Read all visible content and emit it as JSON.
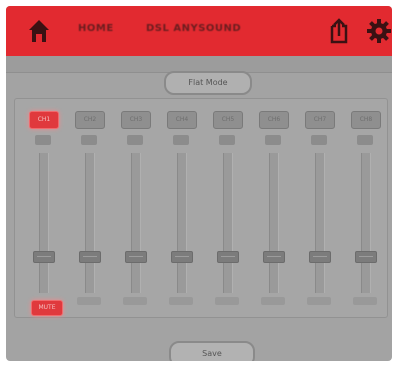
{
  "header": {
    "left_label": "HOME",
    "title": "DSL ANYSOUND",
    "home_icon": "home-icon",
    "share_icon": "share-icon",
    "settings_icon": "gear-icon",
    "bar_color": "#e22a30"
  },
  "preset_label": "Flat Mode",
  "channels": [
    {
      "label": "CH1",
      "active": true
    },
    {
      "label": "CH2",
      "active": false
    },
    {
      "label": "CH3",
      "active": false
    },
    {
      "label": "CH4",
      "active": false
    },
    {
      "label": "CH5",
      "active": false
    },
    {
      "label": "CH6",
      "active": false
    },
    {
      "label": "CH7",
      "active": false
    },
    {
      "label": "CH8",
      "active": false
    }
  ],
  "mute_label": "MUTE",
  "bottom_label": "Save",
  "accent_color": "#e0393d"
}
